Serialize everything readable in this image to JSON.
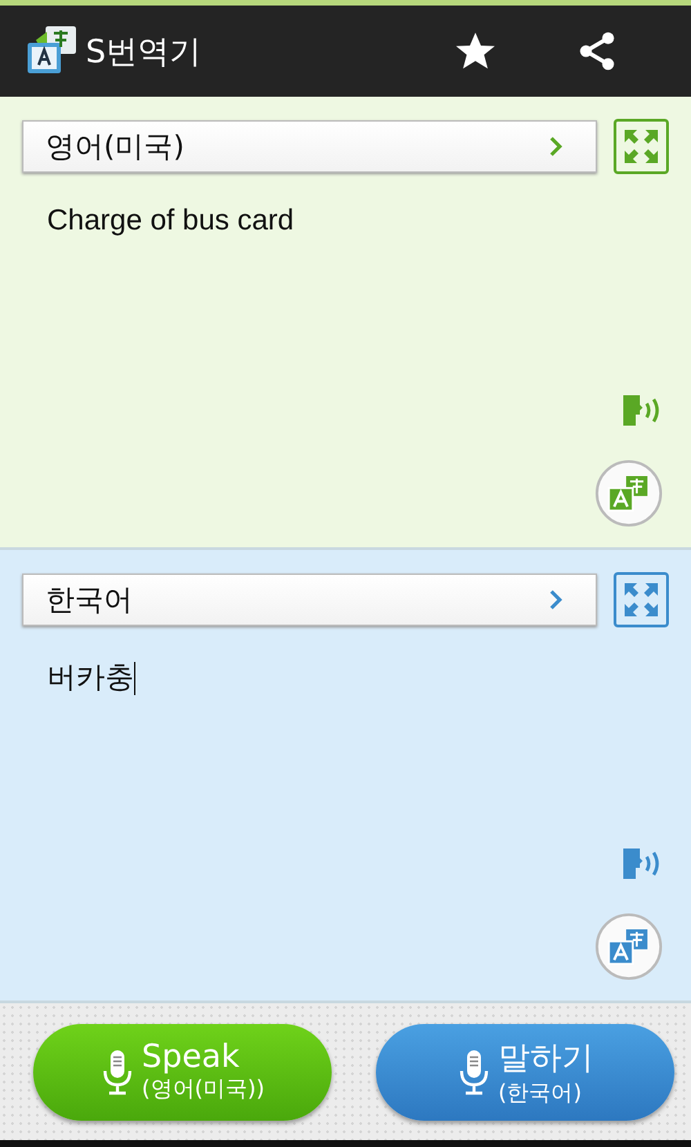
{
  "app_bar": {
    "title": "S번역기"
  },
  "panels": [
    {
      "kind": "source",
      "language": "영어(미국)",
      "text": "Charge of bus card",
      "focused": false
    },
    {
      "kind": "target",
      "language": "한국어",
      "text": "버카충",
      "focused": true
    }
  ],
  "speak_buttons": [
    {
      "kind": "source",
      "label": "Speak",
      "language": "(영어(미국))"
    },
    {
      "kind": "target",
      "label": "말하기",
      "language": "(한국어)"
    }
  ]
}
